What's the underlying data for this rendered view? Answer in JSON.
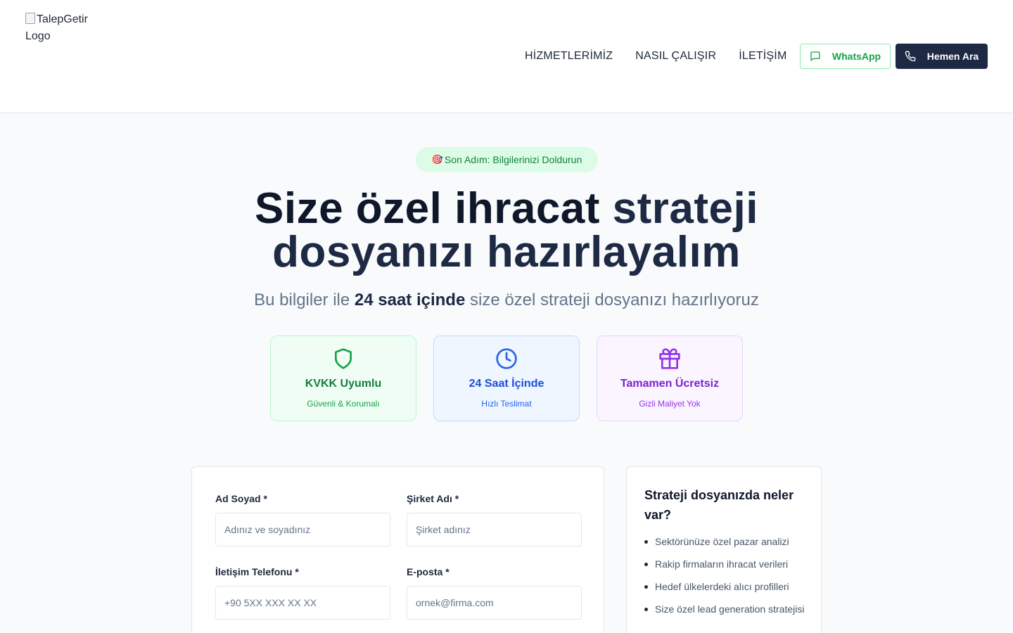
{
  "header": {
    "logo_alt": "TalepGetir Logo",
    "nav": [
      "HİZMETLERİMİZ",
      "NASIL ÇALIŞIR",
      "İLETİŞİM"
    ],
    "whatsapp_label": "WhatsApp",
    "call_label": "Hemen Ara",
    "colors": {
      "whatsapp": "#16a34a",
      "primary": "#1e2a44"
    }
  },
  "hero": {
    "badge_emoji": "🎯",
    "badge_text": "Son Adım: Bilgilerinizi Doldurun",
    "title_part1": "Size özel ihracat ",
    "title_accent": "strateji",
    "title_part2": "dosyanızı hazırlayalım",
    "subtitle_before": "Bu bilgiler ile ",
    "subtitle_bold": "24 saat içinde",
    "subtitle_after": " size özel strateji dosyanızı hazırlıyoruz"
  },
  "features": [
    {
      "icon": "shield-icon",
      "title": "KVKK Uyumlu",
      "subtitle": "Güvenli & Korumalı",
      "color": "#16a34a"
    },
    {
      "icon": "clock-icon",
      "title": "24 Saat İçinde",
      "subtitle": "Hızlı Teslimat",
      "color": "#2563eb"
    },
    {
      "icon": "gift-icon",
      "title": "Tamamen Ücretsiz",
      "subtitle": "Gizli Maliyet Yok",
      "color": "#9333ea"
    }
  ],
  "form": {
    "name": {
      "label": "Ad Soyad *",
      "placeholder": "Adınız ve soyadınız",
      "value": ""
    },
    "company": {
      "label": "Şirket Adı *",
      "placeholder": "Şirket adınız",
      "value": ""
    },
    "phone": {
      "label": "İletişim Telefonu *",
      "placeholder": "+90 5XX XXX XX XX",
      "value": ""
    },
    "email": {
      "label": "E-posta *",
      "placeholder": "ornek@firma.com",
      "value": ""
    }
  },
  "sidebar": {
    "title": "Strateji dosyanızda neler var?",
    "items": [
      "Sektörünüze özel pazar analizi",
      "Rakip firmaların ihracat verileri",
      "Hedef ülkelerdeki alıcı profilleri",
      "Size özel lead generation stratejisi"
    ]
  }
}
